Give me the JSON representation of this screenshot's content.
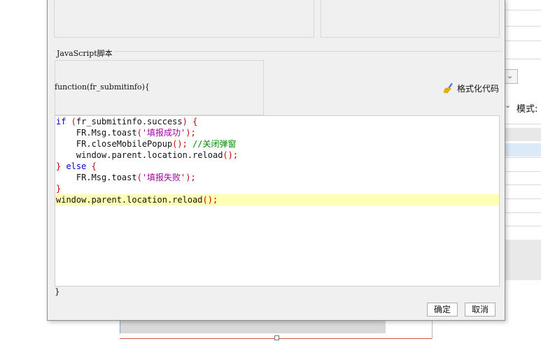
{
  "background": {
    "mode_label": "模式:"
  },
  "dialog": {
    "section_title": "JavaScript脚本",
    "function_header": "function(fr_submitinfo){",
    "function_footer": "}",
    "format_button_label": "格式化代码",
    "format_icon": "broom-icon",
    "ok_label": "确定",
    "cancel_label": "取消",
    "code": {
      "l1_kw": "if",
      "l1_open": " (",
      "l1_text": "fr_submitinfo.success",
      "l1_close": ") {",
      "l2_text": "    FR.Msg.toast",
      "l2_open": "(",
      "l2_str": "'填报成功'",
      "l2_close": ");",
      "l3_text": "    FR.closeMobilePopup",
      "l3_paren": "(); ",
      "l3_comment": "//关闭弹窗",
      "l4_text": "    window.parent.location.reload",
      "l4_paren": "();",
      "l5_close": "} ",
      "l5_kw": "else",
      "l5_open": " {",
      "l6_text": "    FR.Msg.toast",
      "l6_open": "(",
      "l6_str": "'填报失败'",
      "l6_close": ");",
      "l7_close": "}",
      "l8_text": "window.parent.location.reload",
      "l8_paren": "();"
    }
  },
  "colors": {
    "keyword": "#0000cc",
    "bracket": "#cc0000",
    "string": "#a000a0",
    "comment": "#008800",
    "highlight_line": "#ffffb4"
  }
}
